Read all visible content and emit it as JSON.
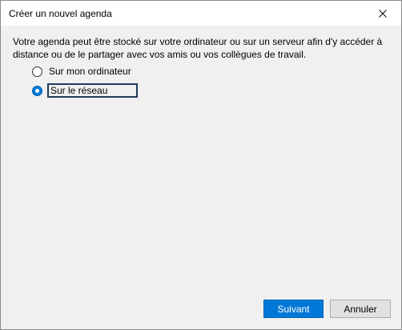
{
  "dialog": {
    "title": "Créer un nouvel agenda",
    "description": "Votre agenda peut être stocké sur votre ordinateur ou sur un serveur afin d'y accéder à distance ou de le partager avec vos amis ou vos collègues de travail.",
    "options": [
      {
        "label": "Sur mon ordinateur",
        "selected": false
      },
      {
        "label": "Sur le réseau",
        "selected": true
      }
    ],
    "buttons": {
      "next": "Suivant",
      "cancel": "Annuler"
    }
  },
  "colors": {
    "accent": "#0078d7",
    "dialog_background": "#f0f0f0",
    "titlebar_background": "#ffffff"
  },
  "icons": {
    "close": "close-icon"
  }
}
